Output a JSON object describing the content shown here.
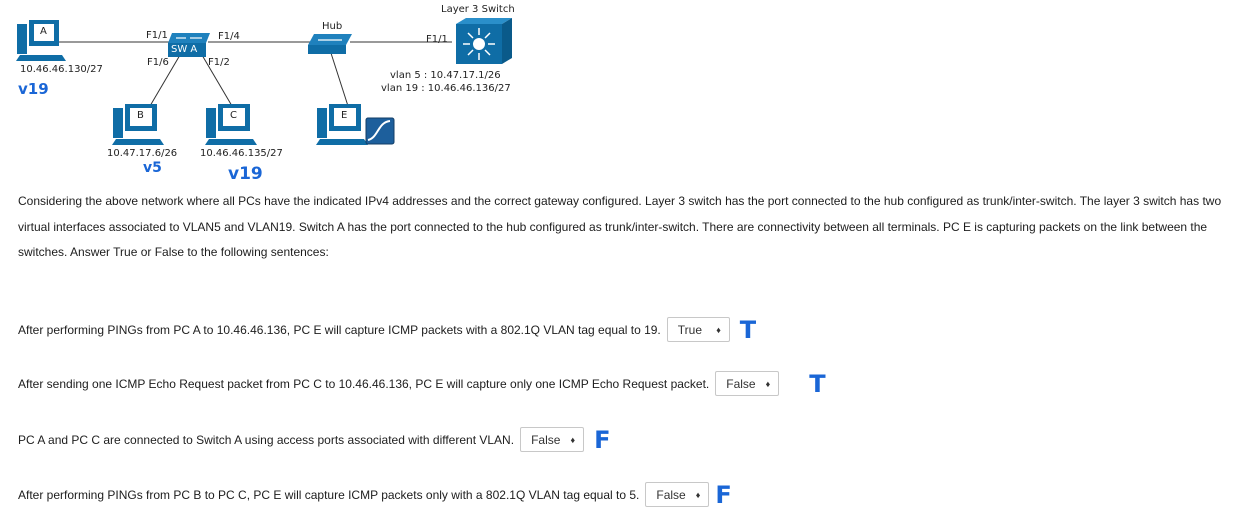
{
  "diagram": {
    "layer3_switch_label": "Layer 3 Switch",
    "hub_label": "Hub",
    "switch_a_label": "SW A",
    "ports": {
      "f1_1_left": "F1/1",
      "f1_4": "F1/4",
      "f1_6": "F1/6",
      "f1_2": "F1/2",
      "f1_1_l3": "F1/1"
    },
    "pc_a": {
      "letter": "A",
      "ip": "10.46.46.130/27",
      "handwritten_vlan": "v19"
    },
    "pc_b": {
      "letter": "B",
      "ip": "10.47.17.6/26",
      "handwritten_vlan": "v5"
    },
    "pc_c": {
      "letter": "C",
      "ip": "10.46.46.135/27",
      "handwritten_vlan": "v19"
    },
    "pc_e": {
      "letter": "E"
    },
    "vlan_interfaces": [
      "vlan 5 : 10.47.17.1/26",
      "vlan 19 : 10.46.46.136/27"
    ]
  },
  "question": {
    "intro": "Considering the above network where all PCs have the indicated IPv4 addresses and the correct gateway configured. Layer 3 switch has the port connected to the hub configured as trunk/inter-switch. The layer 3 switch has two virtual interfaces associated to VLAN5 and VLAN19. Switch A has the port connected to the hub configured as trunk/inter-switch. There are connectivity between all terminals. PC E is capturing packets on the link between the switches. Answer True or False to the following sentences:",
    "statements": [
      {
        "text": "After performing PINGs from PC A to 10.46.46.136, PC E will capture ICMP packets with a 802.1Q VLAN tag equal to 19.",
        "selected": "True",
        "handwritten": "T"
      },
      {
        "text": "After sending one ICMP Echo Request packet from PC C to 10.46.46.136, PC E will capture only one ICMP Echo Request packet.",
        "selected": "False",
        "handwritten": "T"
      },
      {
        "text": "PC A and PC C are connected to Switch A using access ports associated with different VLAN.",
        "selected": "False",
        "handwritten": "F"
      },
      {
        "text": "After performing PINGs from PC B to PC C, PC E will capture ICMP packets only with a 802.1Q VLAN tag equal to 5.",
        "selected": "False",
        "handwritten": "F"
      }
    ],
    "select_caret": "♦"
  },
  "colors": {
    "device_blue": "#0f6da6",
    "handwriting_blue": "#1a66d6"
  }
}
